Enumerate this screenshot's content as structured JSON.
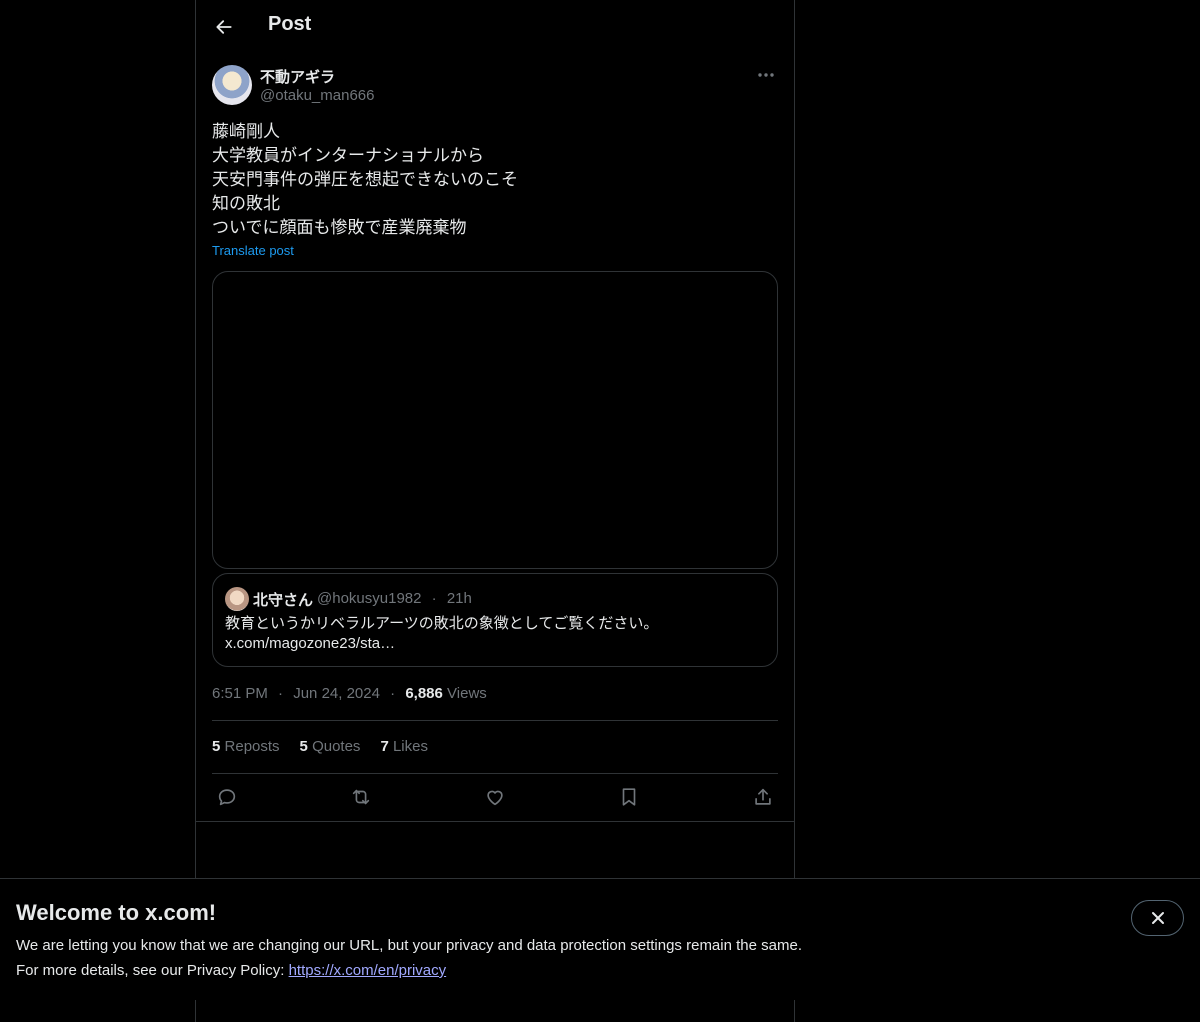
{
  "header": {
    "title": "Post"
  },
  "author": {
    "name": "不動アギラ",
    "handle": "@otaku_man666"
  },
  "post": {
    "text": "藤崎剛人\n大学教員がインターナショナルから\n天安門事件の弾圧を想起できないのこそ\n知の敗北\nついでに顔面も惨敗で産業廃棄物",
    "translate_label": "Translate post"
  },
  "quote": {
    "name": "北守さん",
    "handle": "@hokusyu1982",
    "separator": "·",
    "time": "21h",
    "text_line1": "教育というかリベラルアーツの敗北の象徴としてご覧ください。",
    "text_line2": "x.com/magozone23/sta…"
  },
  "meta": {
    "time": "6:51 PM",
    "date": "Jun 24, 2024",
    "separator": "·",
    "views_count": "6,886",
    "views_label": "Views"
  },
  "stats": {
    "reposts_count": "5",
    "reposts_label": "Reposts",
    "quotes_count": "5",
    "quotes_label": "Quotes",
    "likes_count": "7",
    "likes_label": "Likes"
  },
  "actions": [
    "reply-icon",
    "repost-icon",
    "like-icon",
    "bookmark-icon",
    "share-icon"
  ],
  "banner": {
    "title": "Welcome to x.com!",
    "line1": "We are letting you know that we are changing our URL, but your privacy and data protection settings remain the same.",
    "line2_prefix": "For more details, see our Privacy Policy: ",
    "link": "https://x.com/en/privacy"
  },
  "colors": {
    "accent": "#1d9bf0",
    "muted": "#71767b",
    "border": "#2f3336",
    "link": "#a1a9ff"
  }
}
